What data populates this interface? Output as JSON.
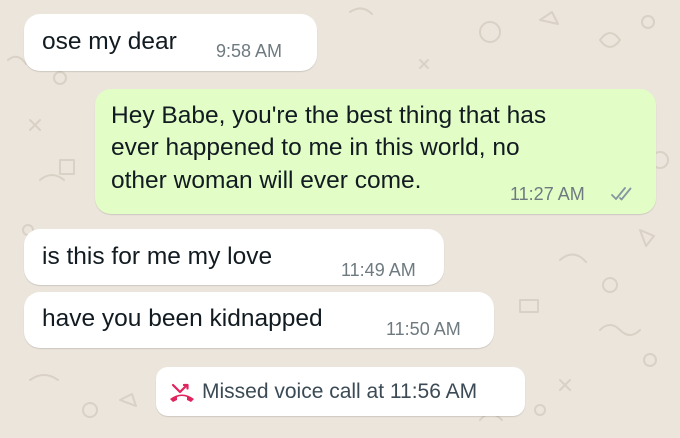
{
  "messages": [
    {
      "direction": "incoming",
      "text": "ose my dear",
      "time": "9:58 AM"
    },
    {
      "direction": "outgoing",
      "lines": [
        "Hey Babe, you're the best thing that has",
        "ever happened to me in this world, no",
        "other woman will ever come."
      ],
      "time": "11:27 AM",
      "status_icon": "double-check-icon"
    },
    {
      "direction": "incoming",
      "text": "is this for me my love",
      "time": "11:49 AM"
    },
    {
      "direction": "incoming",
      "text": "have you been kidnapped",
      "time": "11:50 AM"
    }
  ],
  "system_notice": {
    "icon": "missed-call-icon",
    "text": "Missed voice call at 11:56 AM"
  },
  "colors": {
    "background": "#ebe5dc",
    "incoming_bubble": "#ffffff",
    "outgoing_bubble": "#e2fdc6",
    "missed_call_red": "#e0245e",
    "read_ticks": "#8696a0"
  }
}
